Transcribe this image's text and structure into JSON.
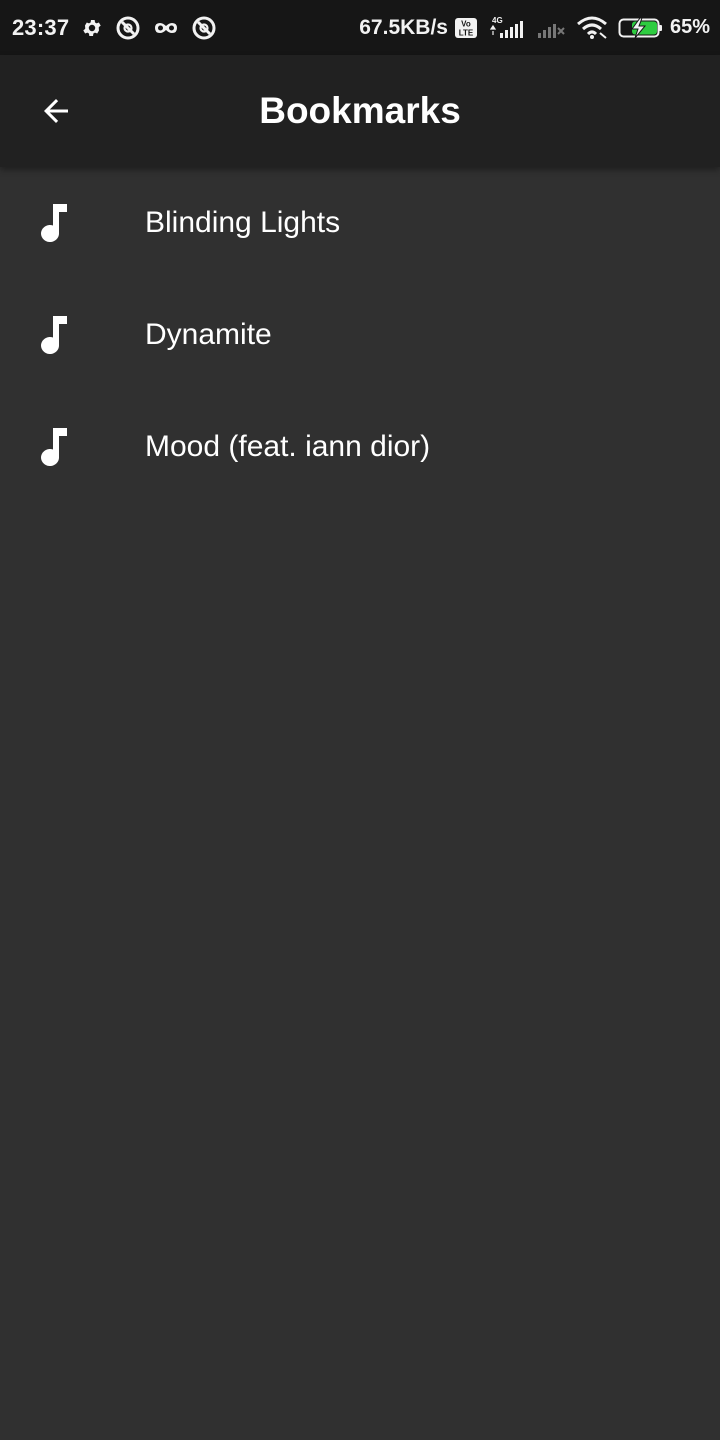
{
  "status_bar": {
    "time": "23:37",
    "net_speed": "67.5KB/s",
    "network_label": "4G",
    "volte_label": "Vo LTE",
    "battery_percent": "65%",
    "icons": [
      "gear-icon",
      "data-saver-icon",
      "incognito-icon",
      "data-saver-icon",
      "volte-icon",
      "signal-icon",
      "signal-off-icon",
      "wifi-icon",
      "battery-charging-icon"
    ],
    "battery_color": "#2ecc40"
  },
  "app_bar": {
    "title": "Bookmarks",
    "back_icon": "arrow-back-icon"
  },
  "bookmarks": [
    {
      "title": "Blinding Lights",
      "icon": "music-note-icon"
    },
    {
      "title": "Dynamite",
      "icon": "music-note-icon"
    },
    {
      "title": "Mood (feat. iann dior)",
      "icon": "music-note-icon"
    }
  ],
  "colors": {
    "background": "#303030",
    "app_bar": "#212121",
    "status_bar": "#161616",
    "text": "#ffffff"
  }
}
